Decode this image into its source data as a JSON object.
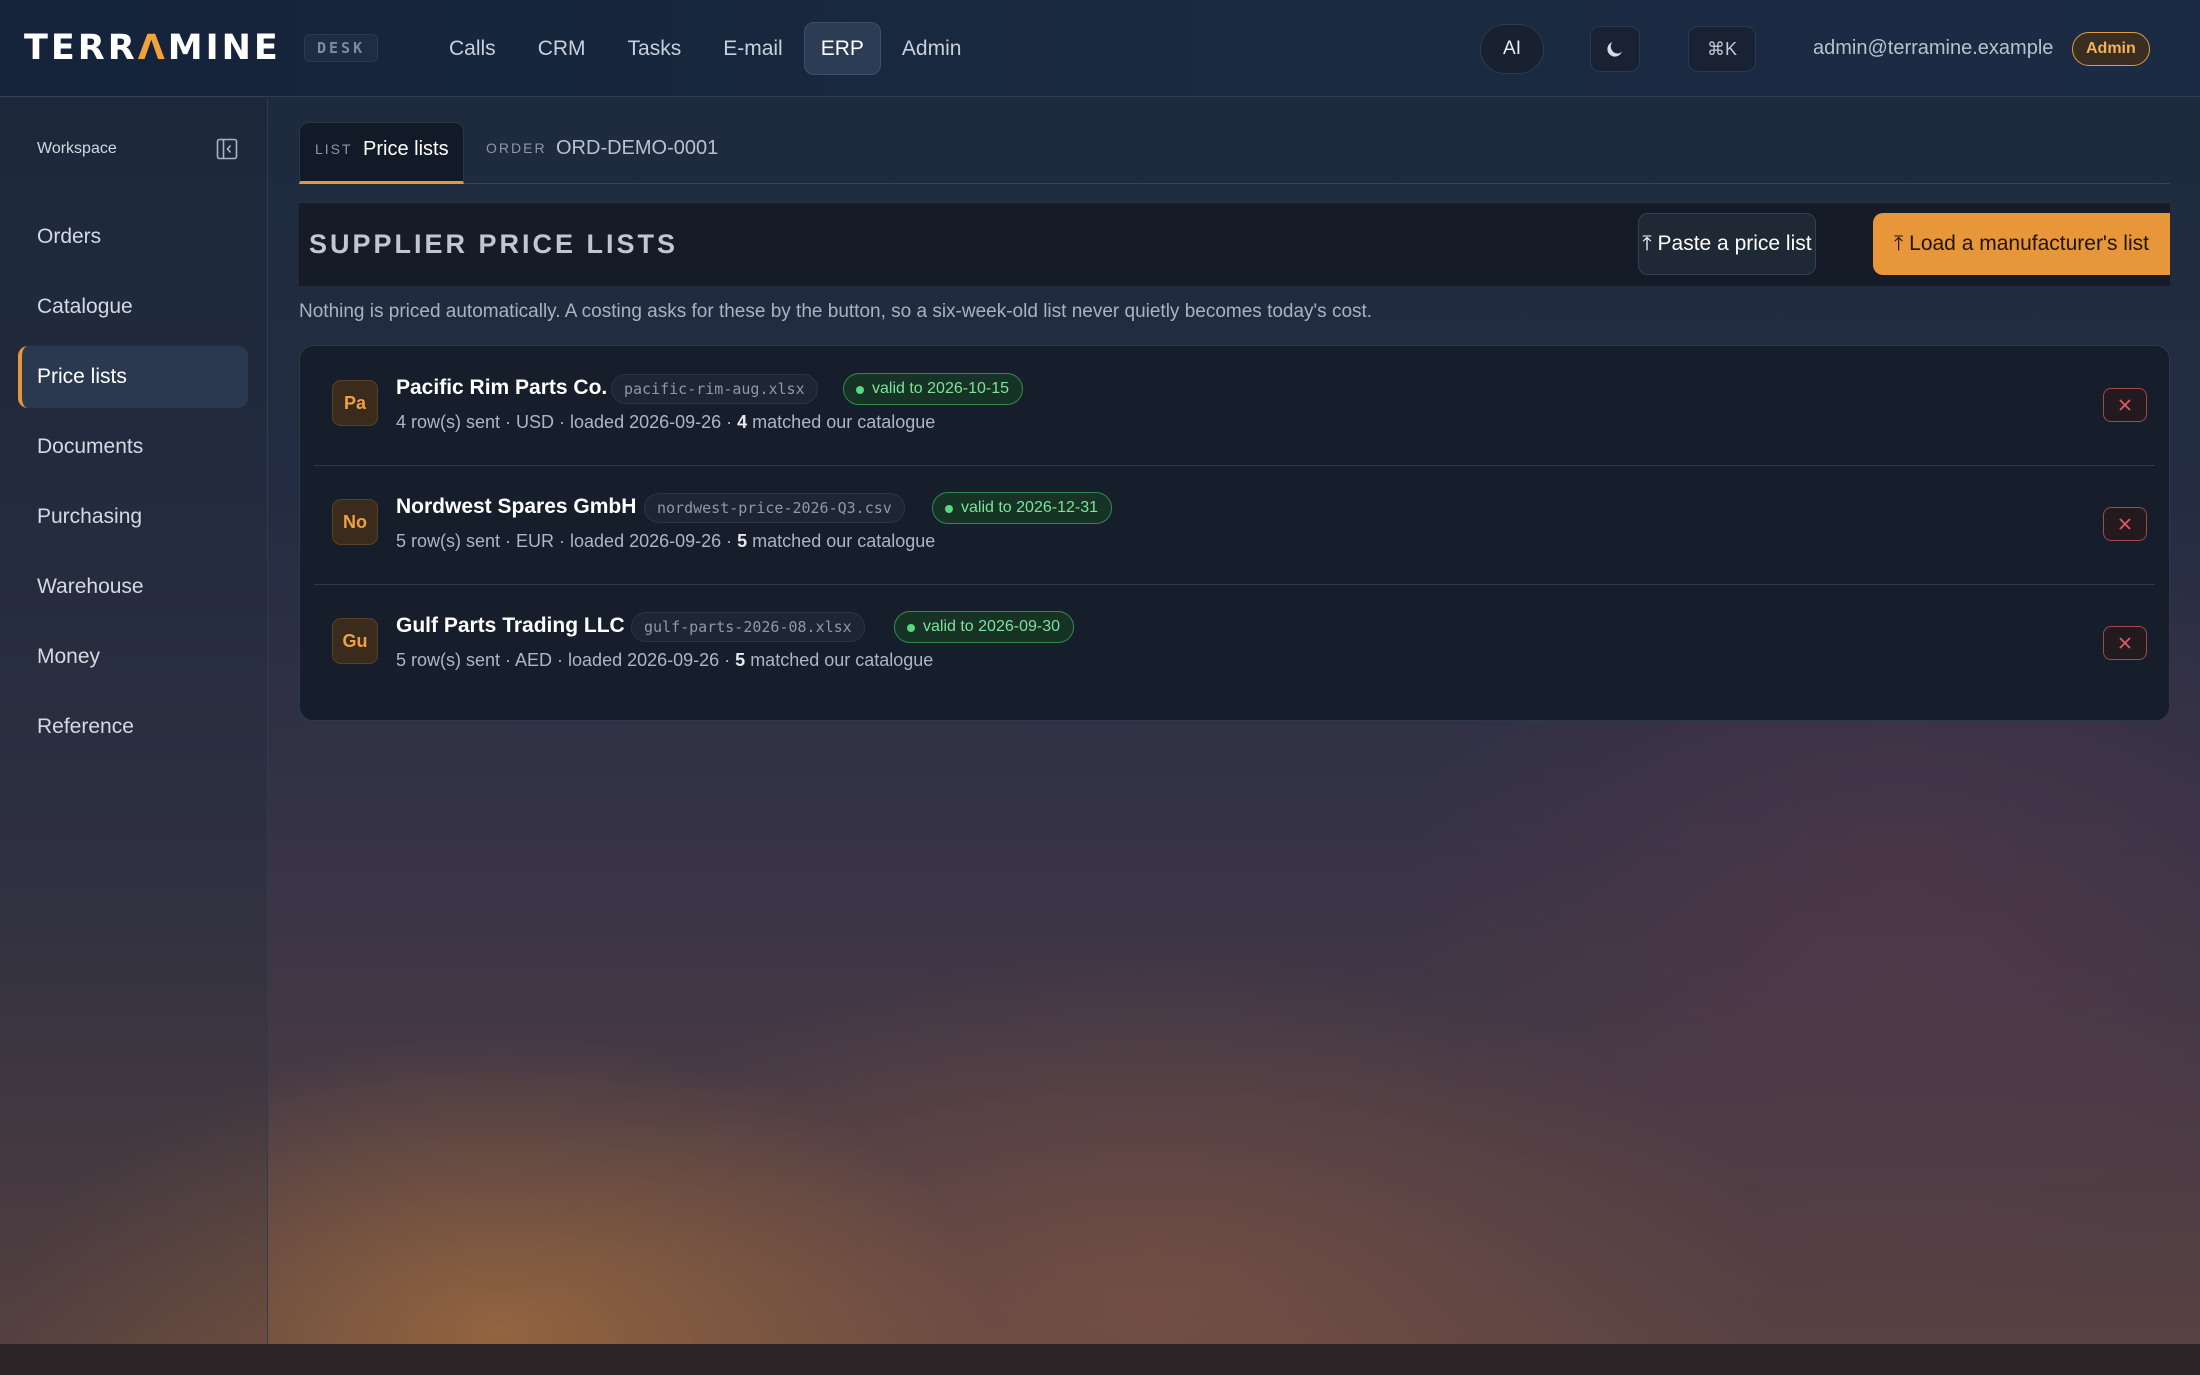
{
  "app": {
    "logo_prefix": "TERR",
    "logo_accent": "Λ",
    "logo_suffix": "MINE",
    "desk_badge": "DESK"
  },
  "nav": {
    "items": [
      {
        "label": "Calls",
        "active": false
      },
      {
        "label": "CRM",
        "active": false
      },
      {
        "label": "Tasks",
        "active": false
      },
      {
        "label": "E-mail",
        "active": false
      },
      {
        "label": "ERP",
        "active": true
      },
      {
        "label": "Admin",
        "active": false
      }
    ],
    "ai_label": "AI",
    "theme_icon": "moon-icon",
    "cmdk_label": "⌘K",
    "user_email": "admin@terramine.example",
    "role_badge": "Admin"
  },
  "sidebar": {
    "workspace_label": "Workspace",
    "collapse_icon": "sidebar-collapse-icon",
    "items": [
      {
        "label": "Orders"
      },
      {
        "label": "Catalogue"
      },
      {
        "label": "Price lists",
        "active": true
      },
      {
        "label": "Documents"
      },
      {
        "label": "Purchasing"
      },
      {
        "label": "Warehouse"
      },
      {
        "label": "Money"
      },
      {
        "label": "Reference"
      }
    ]
  },
  "tabs": {
    "list_kicker": "LIST",
    "list_label": "Price lists",
    "order_kicker": "ORDER",
    "order_label": "ORD-DEMO-0001"
  },
  "section": {
    "title": "SUPPLIER PRICE LISTS",
    "paste_button": "⤒ Paste a price list",
    "load_button": "⤒ Load a manufacturer's list",
    "notice": "Nothing is priced automatically. A costing asks for these by the button, so a six-week-old list never quietly becomes today's cost."
  },
  "price_lists": [
    {
      "initials": "Pa",
      "supplier": "Pacific Rim Parts Co.",
      "file": "pacific-rim-aug.xlsx",
      "valid": "valid to 2026-10-15",
      "meta_prefix": "4 row(s) sent · USD · loaded 2026-09-26 · ",
      "matched": "4",
      "meta_suffix": " matched our catalogue"
    },
    {
      "initials": "No",
      "supplier": "Nordwest Spares GmbH",
      "file": "nordwest-price-2026-Q3.csv",
      "valid": "valid to 2026-12-31",
      "meta_prefix": "5 row(s) sent · EUR · loaded 2026-09-26 · ",
      "matched": "5",
      "meta_suffix": " matched our catalogue"
    },
    {
      "initials": "Gu",
      "supplier": "Gulf Parts Trading LLC",
      "file": "gulf-parts-2026-08.xlsx",
      "valid": "valid to 2026-09-30",
      "meta_prefix": "5 row(s) sent · AED · loaded 2026-09-26 · ",
      "matched": "5",
      "meta_suffix": " matched our catalogue"
    }
  ],
  "colors": {
    "accent": "#e8963a",
    "valid_green": "#7de39a",
    "danger": "#e05a5a"
  }
}
